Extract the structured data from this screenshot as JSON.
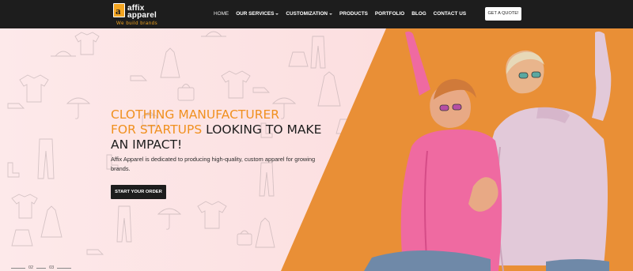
{
  "brand": {
    "name_line1": "affix",
    "name_line2": "apparel",
    "mark": "a",
    "tagline": "We build brands"
  },
  "nav": {
    "items": [
      {
        "label": "HOME",
        "active": true
      },
      {
        "label": "OUR SERVICES",
        "dropdown": true
      },
      {
        "label": "CUSTOMIZATION",
        "dropdown": true
      },
      {
        "label": "PRODUCTS"
      },
      {
        "label": "PORTFOLIO"
      },
      {
        "label": "BLOG"
      },
      {
        "label": "CONTACT US"
      }
    ],
    "cta": "GET A QUOTE!"
  },
  "hero": {
    "headline_part1": "CLOTHING MANUFACTURER",
    "headline_part2": "FOR STARTUPS",
    "headline_part3": "LOOKING TO MAKE",
    "headline_part4": "AN IMPACT!",
    "description": "Affix Apparel is dedicated to producing high-quality, custom apparel for growing brands.",
    "button": "START YOUR ORDER"
  },
  "slider": {
    "labels": [
      "02",
      "03"
    ]
  },
  "colors": {
    "accent": "#f0901f",
    "header_bg": "#1d1d1d",
    "hero_pink": "#fde9ea",
    "hero_orange": "#e98f36"
  }
}
